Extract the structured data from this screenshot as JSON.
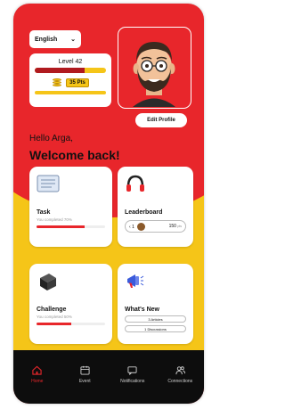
{
  "colors": {
    "primary_red": "#e8262b",
    "accent_yellow": "#f5c518",
    "nav_background": "#0d0d0d"
  },
  "header": {
    "language": "English",
    "level": {
      "label": "Level 42",
      "progress_fraction": 0.7
    },
    "points": "35 Pts",
    "avatar_icon": "memoji-avatar",
    "edit_profile_label": "Edit Profile"
  },
  "greeting": {
    "hello": "Hello Arga,",
    "welcome": "Welcome back!"
  },
  "cards": {
    "task": {
      "title": "Task",
      "subtitle": "You completed 70%",
      "progress_fraction": 0.7,
      "icon": "checklist-icon"
    },
    "leaderboard": {
      "title": "Leaderboard",
      "rank": "1",
      "score": "150",
      "score_unit": "pts",
      "icon": "headphones-icon"
    },
    "challenge": {
      "title": "Challenge",
      "subtitle": "You completed 50%",
      "progress_fraction": 0.5,
      "icon": "box-icon"
    },
    "whats_new": {
      "title": "What's New",
      "articles": "3 Articles",
      "discussions": "1 Discussions",
      "icon": "megaphone-icon"
    }
  },
  "nav": {
    "items": [
      {
        "label": "Home",
        "icon": "home-icon",
        "active": true
      },
      {
        "label": "Event",
        "icon": "calendar-icon",
        "active": false
      },
      {
        "label": "Notifications",
        "icon": "chat-icon",
        "active": false
      },
      {
        "label": "Connections",
        "icon": "users-icon",
        "active": false
      }
    ]
  }
}
